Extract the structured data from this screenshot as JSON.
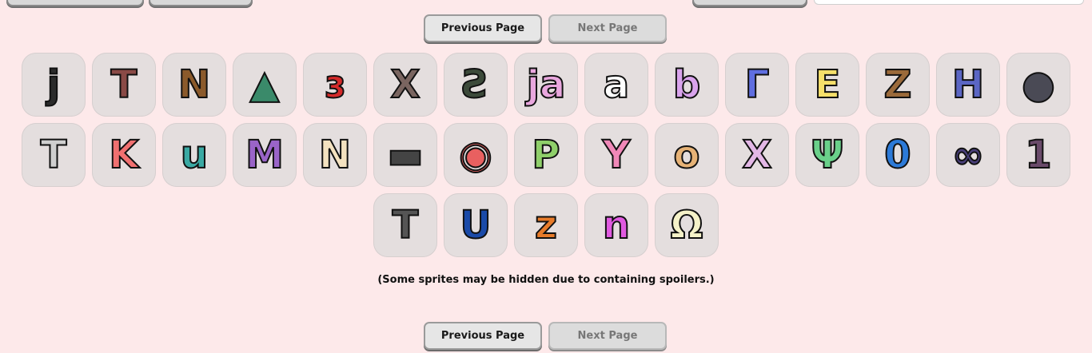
{
  "pagination": {
    "previous_label": "Previous Page",
    "next_label": "Next Page"
  },
  "sprites": [
    [
      {
        "icon": "letter-j-sprite",
        "glyph": "j",
        "fill": "#2b2b2b"
      },
      {
        "icon": "letter-t-sprite",
        "glyph": "T",
        "fill": "#8a4a46"
      },
      {
        "icon": "letter-n-sprite",
        "glyph": "N",
        "fill": "#8b5a2b"
      },
      {
        "icon": "triangle-sprite",
        "glyph": "▲",
        "fill": "#3a8a6a"
      },
      {
        "icon": "letter-3-sprite",
        "glyph": "ɜ",
        "fill": "#d42a2a"
      },
      {
        "icon": "letter-x-sprite",
        "glyph": "X",
        "fill": "#7a6560"
      },
      {
        "icon": "letter-ezh-sprite",
        "glyph": "Ƨ",
        "fill": "#3c4a3a"
      },
      {
        "icon": "letter-ja-sprite",
        "glyph": "ja",
        "fill": "#e9a7de"
      },
      {
        "icon": "letter-a-sprite",
        "glyph": "a",
        "fill": "#ffffff"
      },
      {
        "icon": "letter-b-sprite",
        "glyph": "b",
        "fill": "#d9a3ec"
      },
      {
        "icon": "letter-gamma-sprite",
        "glyph": "Γ",
        "fill": "#5f6ee0"
      },
      {
        "icon": "letter-e-sprite",
        "glyph": "E",
        "fill": "#f5df6a"
      },
      {
        "icon": "letter-z-sprite",
        "glyph": "Z",
        "fill": "#9b6a3a"
      },
      {
        "icon": "letter-h-sprite",
        "glyph": "H",
        "fill": "#5b66c4"
      },
      {
        "icon": "orb-sprite",
        "glyph": "●",
        "fill": "#4a4a55"
      }
    ],
    [
      {
        "icon": "letter-t-box-sprite",
        "glyph": "T",
        "fill": "#cfcfcf"
      },
      {
        "icon": "letter-k-sprite",
        "glyph": "K",
        "fill": "#f07070"
      },
      {
        "icon": "letter-u-sprite",
        "glyph": "u",
        "fill": "#3aa9a3"
      },
      {
        "icon": "letter-m-sprite",
        "glyph": "M",
        "fill": "#9a64c8"
      },
      {
        "icon": "letter-n-bandage-sprite",
        "glyph": "N",
        "fill": "#f4e2c0"
      },
      {
        "icon": "monster-mouth-sprite",
        "glyph": "▬",
        "fill": "#444444"
      },
      {
        "icon": "eyes-sprite",
        "glyph": "◉",
        "fill": "#e86060"
      },
      {
        "icon": "letter-p-sprite",
        "glyph": "P",
        "fill": "#8fcf6a"
      },
      {
        "icon": "letter-y-sprite",
        "glyph": "Y",
        "fill": "#f088b8"
      },
      {
        "icon": "letter-o-sprite",
        "glyph": "o",
        "fill": "#e6b276"
      },
      {
        "icon": "letter-x-pink-sprite",
        "glyph": "X",
        "fill": "#e3b7e6"
      },
      {
        "icon": "letter-psi-sprite",
        "glyph": "Ψ",
        "fill": "#6ad08a"
      },
      {
        "icon": "letter-0-sprite",
        "glyph": "0",
        "fill": "#2c7ad8"
      },
      {
        "icon": "caterpillar-sprite",
        "glyph": "∞",
        "fill": "#4a3f7a"
      },
      {
        "icon": "letter-1-sprite",
        "glyph": "1",
        "fill": "#6a4a6a"
      }
    ],
    [
      {
        "icon": "hammer-sprite",
        "glyph": "T",
        "fill": "#555555"
      },
      {
        "icon": "letter-u-blue-sprite",
        "glyph": "U",
        "fill": "#1a4aa8"
      },
      {
        "icon": "ant-sprite",
        "glyph": "z",
        "fill": "#e77b2a"
      },
      {
        "icon": "letter-n-magenta-sprite",
        "glyph": "n",
        "fill": "#e05ae0"
      },
      {
        "icon": "letter-omega-sprite",
        "glyph": "Ω",
        "fill": "#f5f2c8"
      }
    ]
  ],
  "spoiler_note": "(Some sprites may be hidden due to containing spoilers.)"
}
